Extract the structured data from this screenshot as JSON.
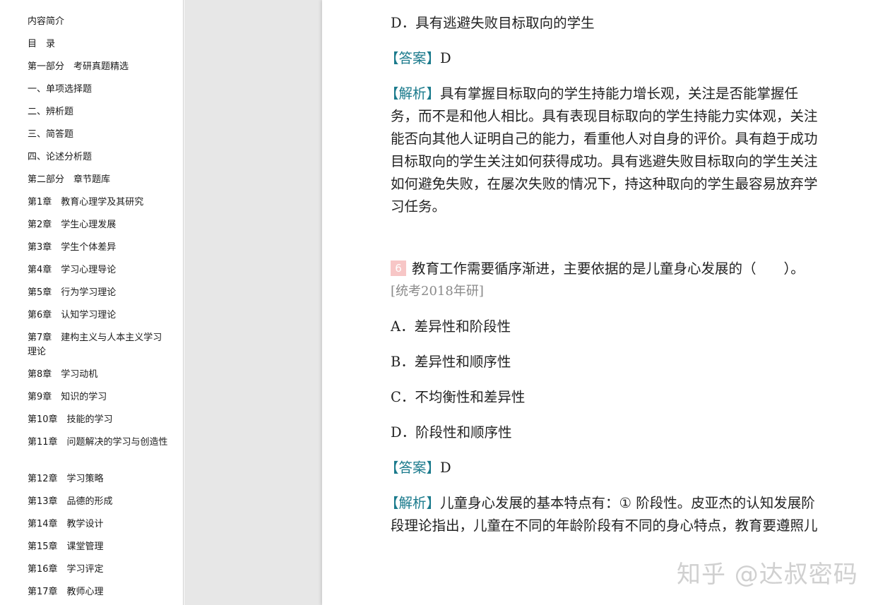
{
  "toc": [
    "内容简介",
    "目　录",
    "第一部分　考研真题精选",
    "一、单项选择题",
    "二、辨析题",
    "三、简答题",
    "四、论述分析题",
    "第二部分　章节题库",
    "第1章　教育心理学及其研究",
    "第2章　学生心理发展",
    "第3章　学生个体差异",
    "第4章　学习心理导论",
    "第5章　行为学习理论",
    "第6章　认知学习理论",
    "第7章　建构主义与人本主义学习理论",
    "第8章　学习动机",
    "第9章　知识的学习",
    "第10章　技能的学习",
    "第11章　问题解决的学习与创造性",
    "第12章　学习策略",
    "第13章　品德的形成",
    "第14章　教学设计",
    "第15章　课堂管理",
    "第16章　学习评定",
    "第17章　教师心理"
  ],
  "q5": {
    "option_d_letter": "D",
    "option_d_text": "．具有逃避失败目标取向的学生",
    "answer_tag": "【答案】",
    "answer_value": "D",
    "analysis_tag": "【解析】",
    "analysis_lines": [
      "具有掌握目标取向的学生持能力增长观，关注是否能掌握任",
      "务，而不是和他人相比。具有表现目标取向的学生持能力实体观，关注",
      "能否向其他人证明自己的能力，看重他人对自身的评价。具有趋于成功",
      "目标取向的学生关注如何获得成功。具有逃避失败目标取向的学生关注",
      "如何避免失败，在屡次失败的情况下，持这种取向的学生最容易放弃学",
      "习任务。"
    ]
  },
  "q6": {
    "number": "6",
    "stem": "教育工作需要循序渐进，主要依据的是儿童身心发展的（　　）。",
    "source": "[统考2018年研]",
    "options": [
      {
        "letter": "A",
        "text": "．差异性和阶段性"
      },
      {
        "letter": "B",
        "text": "．差异性和顺序性"
      },
      {
        "letter": "C",
        "text": "．不均衡性和差异性"
      },
      {
        "letter": "D",
        "text": "．阶段性和顺序性"
      }
    ],
    "answer_tag": "【答案】",
    "answer_value": "D",
    "analysis_tag": "【解析】",
    "analysis_lines": [
      "儿童身心发展的基本特点有：① 阶段性。皮亚杰的认知发展阶",
      "段理论指出，儿童在不同的年龄阶段有不同的身心特点，教育要遵照儿"
    ]
  },
  "watermark": "知乎 @达叔密码",
  "colors": {
    "tag_teal": "#1a7a8c",
    "qnum_badge": "#f7c6c6",
    "gutter_gray": "#e7e7e7"
  }
}
